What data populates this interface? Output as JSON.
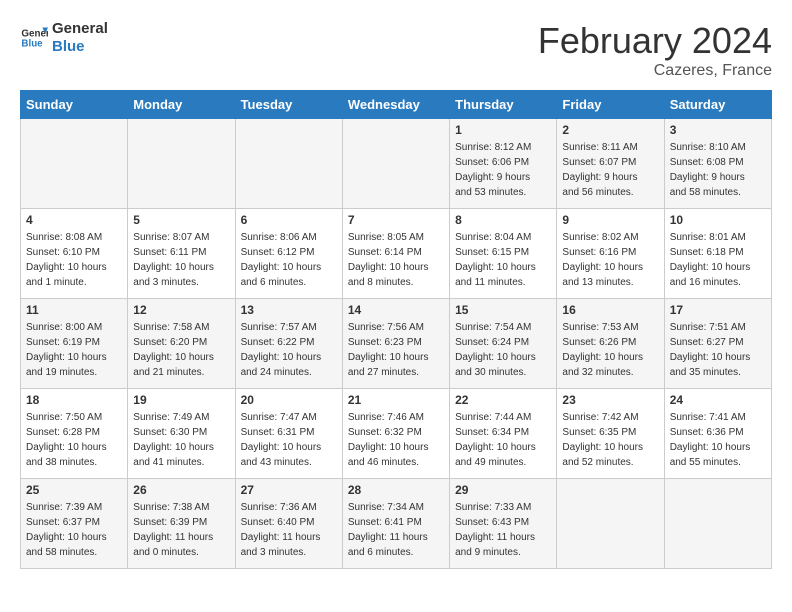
{
  "header": {
    "logo_line1": "General",
    "logo_line2": "Blue",
    "month_title": "February 2024",
    "location": "Cazeres, France"
  },
  "days_of_week": [
    "Sunday",
    "Monday",
    "Tuesday",
    "Wednesday",
    "Thursday",
    "Friday",
    "Saturday"
  ],
  "weeks": [
    [
      {
        "day": "",
        "info": ""
      },
      {
        "day": "",
        "info": ""
      },
      {
        "day": "",
        "info": ""
      },
      {
        "day": "",
        "info": ""
      },
      {
        "day": "1",
        "info": "Sunrise: 8:12 AM\nSunset: 6:06 PM\nDaylight: 9 hours\nand 53 minutes."
      },
      {
        "day": "2",
        "info": "Sunrise: 8:11 AM\nSunset: 6:07 PM\nDaylight: 9 hours\nand 56 minutes."
      },
      {
        "day": "3",
        "info": "Sunrise: 8:10 AM\nSunset: 6:08 PM\nDaylight: 9 hours\nand 58 minutes."
      }
    ],
    [
      {
        "day": "4",
        "info": "Sunrise: 8:08 AM\nSunset: 6:10 PM\nDaylight: 10 hours\nand 1 minute."
      },
      {
        "day": "5",
        "info": "Sunrise: 8:07 AM\nSunset: 6:11 PM\nDaylight: 10 hours\nand 3 minutes."
      },
      {
        "day": "6",
        "info": "Sunrise: 8:06 AM\nSunset: 6:12 PM\nDaylight: 10 hours\nand 6 minutes."
      },
      {
        "day": "7",
        "info": "Sunrise: 8:05 AM\nSunset: 6:14 PM\nDaylight: 10 hours\nand 8 minutes."
      },
      {
        "day": "8",
        "info": "Sunrise: 8:04 AM\nSunset: 6:15 PM\nDaylight: 10 hours\nand 11 minutes."
      },
      {
        "day": "9",
        "info": "Sunrise: 8:02 AM\nSunset: 6:16 PM\nDaylight: 10 hours\nand 13 minutes."
      },
      {
        "day": "10",
        "info": "Sunrise: 8:01 AM\nSunset: 6:18 PM\nDaylight: 10 hours\nand 16 minutes."
      }
    ],
    [
      {
        "day": "11",
        "info": "Sunrise: 8:00 AM\nSunset: 6:19 PM\nDaylight: 10 hours\nand 19 minutes."
      },
      {
        "day": "12",
        "info": "Sunrise: 7:58 AM\nSunset: 6:20 PM\nDaylight: 10 hours\nand 21 minutes."
      },
      {
        "day": "13",
        "info": "Sunrise: 7:57 AM\nSunset: 6:22 PM\nDaylight: 10 hours\nand 24 minutes."
      },
      {
        "day": "14",
        "info": "Sunrise: 7:56 AM\nSunset: 6:23 PM\nDaylight: 10 hours\nand 27 minutes."
      },
      {
        "day": "15",
        "info": "Sunrise: 7:54 AM\nSunset: 6:24 PM\nDaylight: 10 hours\nand 30 minutes."
      },
      {
        "day": "16",
        "info": "Sunrise: 7:53 AM\nSunset: 6:26 PM\nDaylight: 10 hours\nand 32 minutes."
      },
      {
        "day": "17",
        "info": "Sunrise: 7:51 AM\nSunset: 6:27 PM\nDaylight: 10 hours\nand 35 minutes."
      }
    ],
    [
      {
        "day": "18",
        "info": "Sunrise: 7:50 AM\nSunset: 6:28 PM\nDaylight: 10 hours\nand 38 minutes."
      },
      {
        "day": "19",
        "info": "Sunrise: 7:49 AM\nSunset: 6:30 PM\nDaylight: 10 hours\nand 41 minutes."
      },
      {
        "day": "20",
        "info": "Sunrise: 7:47 AM\nSunset: 6:31 PM\nDaylight: 10 hours\nand 43 minutes."
      },
      {
        "day": "21",
        "info": "Sunrise: 7:46 AM\nSunset: 6:32 PM\nDaylight: 10 hours\nand 46 minutes."
      },
      {
        "day": "22",
        "info": "Sunrise: 7:44 AM\nSunset: 6:34 PM\nDaylight: 10 hours\nand 49 minutes."
      },
      {
        "day": "23",
        "info": "Sunrise: 7:42 AM\nSunset: 6:35 PM\nDaylight: 10 hours\nand 52 minutes."
      },
      {
        "day": "24",
        "info": "Sunrise: 7:41 AM\nSunset: 6:36 PM\nDaylight: 10 hours\nand 55 minutes."
      }
    ],
    [
      {
        "day": "25",
        "info": "Sunrise: 7:39 AM\nSunset: 6:37 PM\nDaylight: 10 hours\nand 58 minutes."
      },
      {
        "day": "26",
        "info": "Sunrise: 7:38 AM\nSunset: 6:39 PM\nDaylight: 11 hours\nand 0 minutes."
      },
      {
        "day": "27",
        "info": "Sunrise: 7:36 AM\nSunset: 6:40 PM\nDaylight: 11 hours\nand 3 minutes."
      },
      {
        "day": "28",
        "info": "Sunrise: 7:34 AM\nSunset: 6:41 PM\nDaylight: 11 hours\nand 6 minutes."
      },
      {
        "day": "29",
        "info": "Sunrise: 7:33 AM\nSunset: 6:43 PM\nDaylight: 11 hours\nand 9 minutes."
      },
      {
        "day": "",
        "info": ""
      },
      {
        "day": "",
        "info": ""
      }
    ]
  ]
}
